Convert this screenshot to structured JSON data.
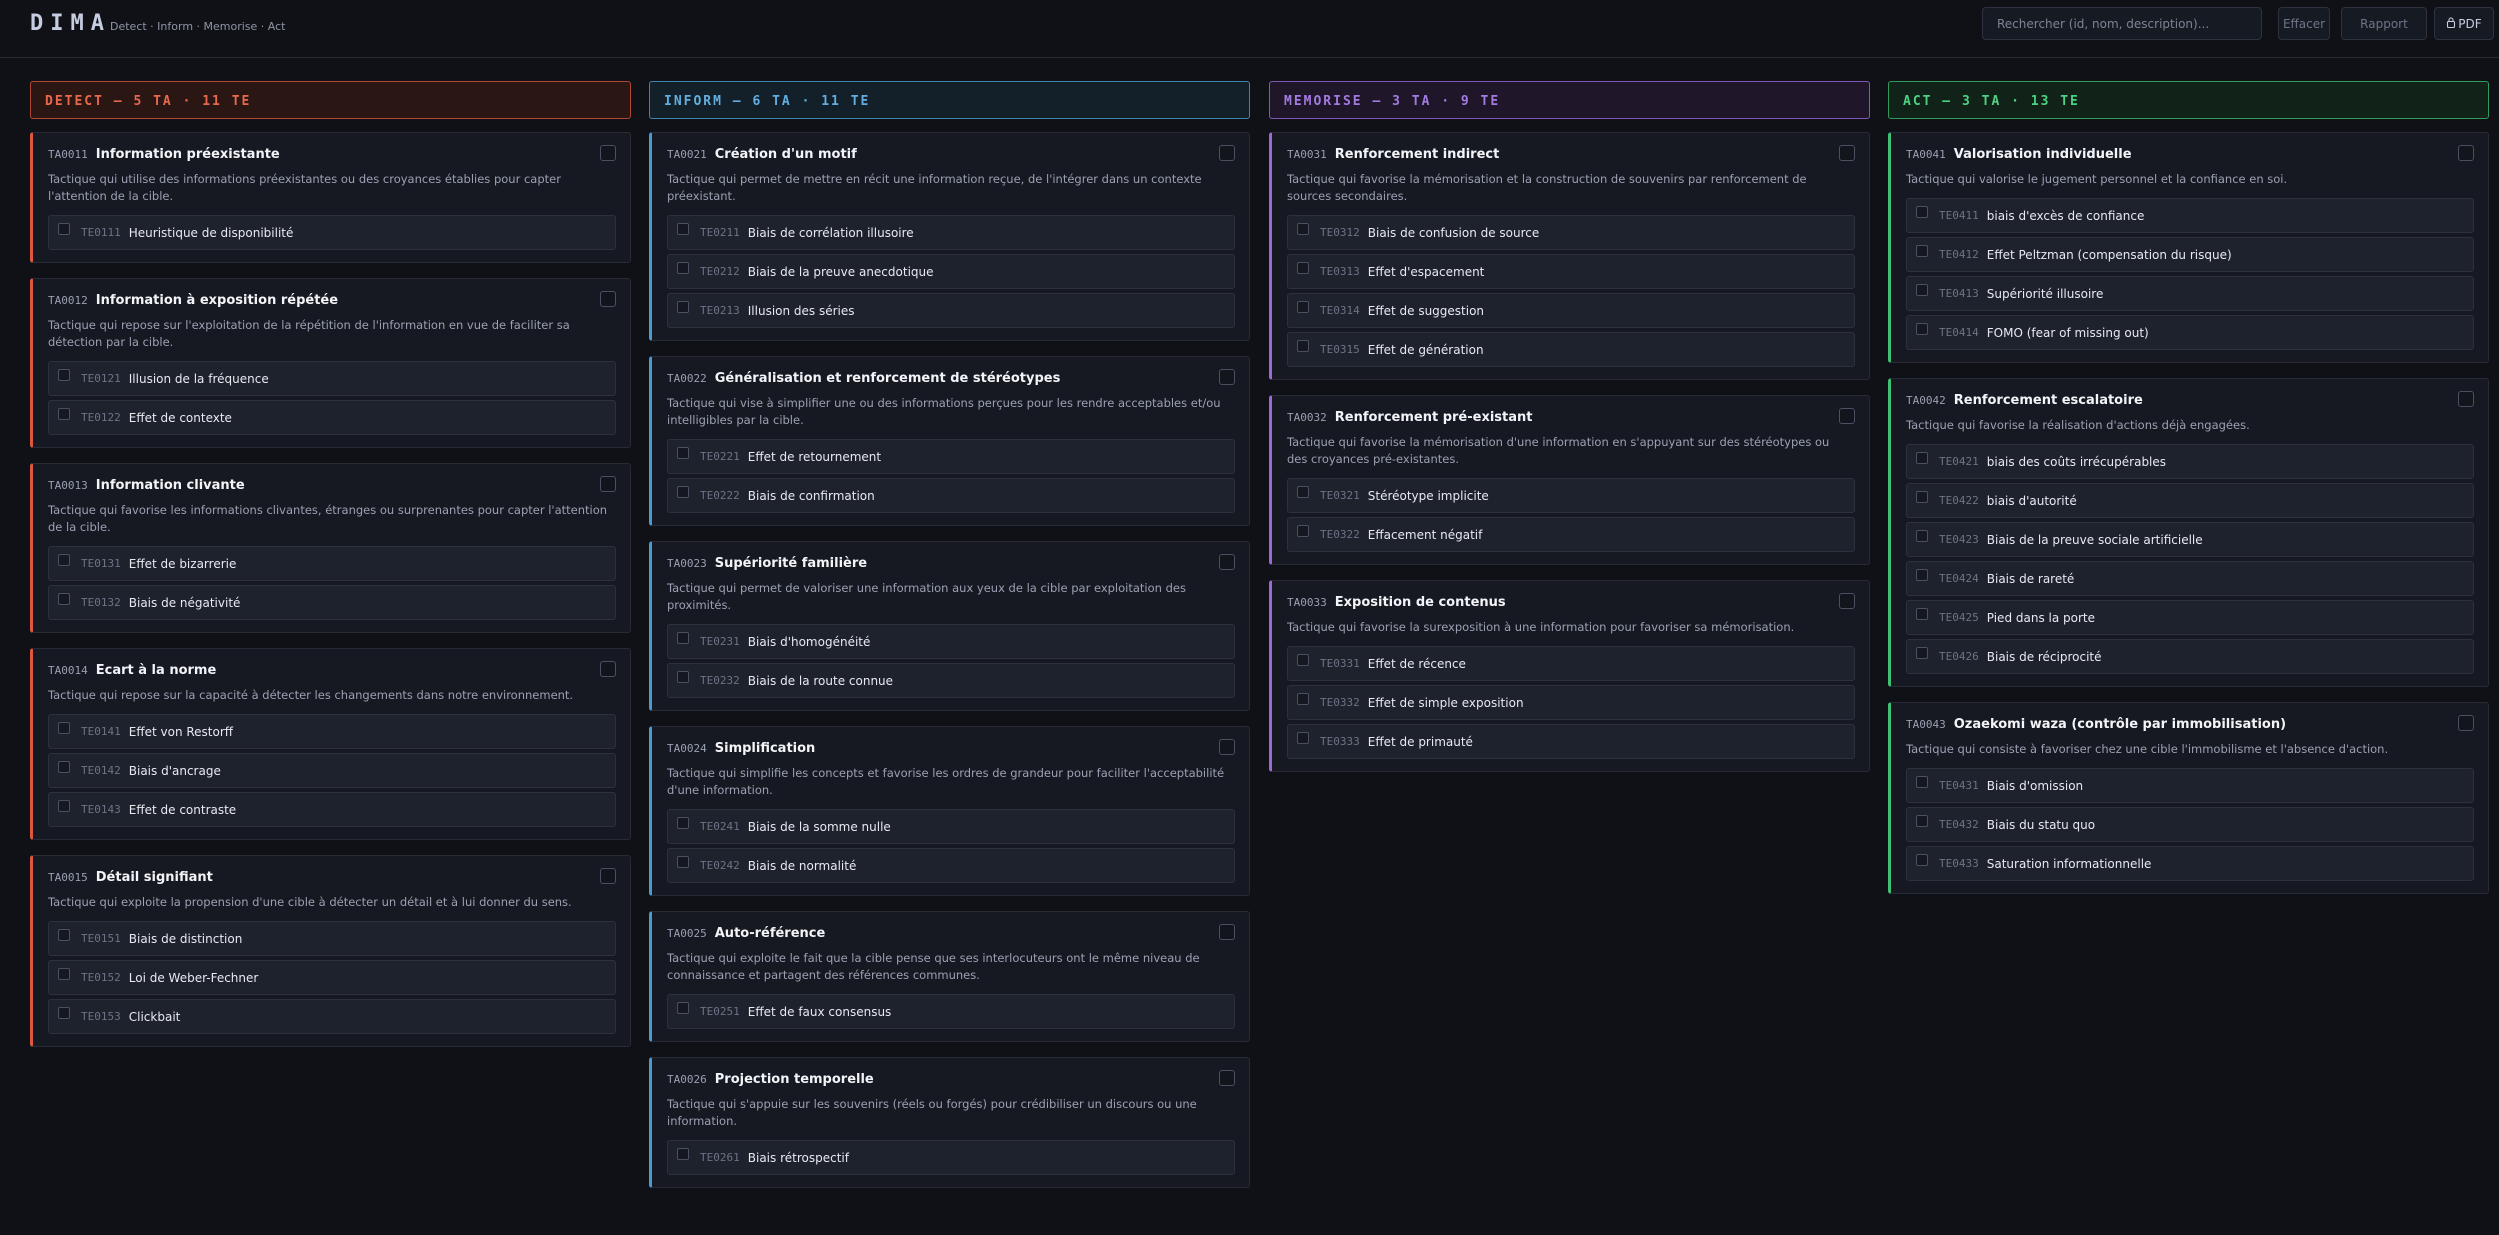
{
  "app": {
    "logo": "DIMA",
    "tagline": "Detect · Inform · Memorise · Act"
  },
  "toolbar": {
    "search_placeholder": "Rechercher (id, nom, description)...",
    "clear_label": "Effacer",
    "report_label": "Rapport",
    "pdf_label": "PDF",
    "pdf_icon": "lock-icon"
  },
  "colors": {
    "detect": "#e0573f",
    "inform": "#4a9bcf",
    "memorise": "#9a6ad6",
    "act": "#3fc174",
    "background": "#0f1117"
  },
  "columns": [
    {
      "header": "DETECT — 5 TA · 11 TE",
      "cards": [
        {
          "id": "TA0011",
          "name": "Information préexistante",
          "desc": "Tactique qui utilise des informations préexistantes ou des croyances établies pour capter l'attention de la cible.",
          "items": [
            {
              "id": "TE0111",
              "name": "Heuristique de disponibilité"
            }
          ]
        },
        {
          "id": "TA0012",
          "name": "Information à exposition répétée",
          "desc": "Tactique qui repose sur l'exploitation de la répétition de l'information en vue de faciliter sa détection par la cible.",
          "items": [
            {
              "id": "TE0121",
              "name": "Illusion de la fréquence"
            },
            {
              "id": "TE0122",
              "name": "Effet de contexte"
            }
          ]
        },
        {
          "id": "TA0013",
          "name": "Information clivante",
          "desc": "Tactique qui favorise les informations clivantes, étranges ou surprenantes pour capter l'attention de la cible.",
          "items": [
            {
              "id": "TE0131",
              "name": "Effet de bizarrerie"
            },
            {
              "id": "TE0132",
              "name": "Biais de négativité"
            }
          ]
        },
        {
          "id": "TA0014",
          "name": "Ecart à la norme",
          "desc": "Tactique qui repose sur la capacité à détecter les changements dans notre environnement.",
          "items": [
            {
              "id": "TE0141",
              "name": "Effet von Restorff"
            },
            {
              "id": "TE0142",
              "name": "Biais d'ancrage"
            },
            {
              "id": "TE0143",
              "name": "Effet de contraste"
            }
          ]
        },
        {
          "id": "TA0015",
          "name": "Détail signifiant",
          "desc": "Tactique qui exploite la propension d'une cible à détecter un détail et à lui donner du sens.",
          "items": [
            {
              "id": "TE0151",
              "name": "Biais de distinction"
            },
            {
              "id": "TE0152",
              "name": "Loi de Weber-Fechner"
            },
            {
              "id": "TE0153",
              "name": "Clickbait"
            }
          ]
        }
      ]
    },
    {
      "header": "INFORM — 6 TA · 11 TE",
      "cards": [
        {
          "id": "TA0021",
          "name": "Création d'un motif",
          "desc": "Tactique qui permet de mettre en récit une information reçue, de l'intégrer dans un contexte préexistant.",
          "items": [
            {
              "id": "TE0211",
              "name": "Biais de corrélation illusoire"
            },
            {
              "id": "TE0212",
              "name": "Biais de la preuve anecdotique"
            },
            {
              "id": "TE0213",
              "name": "Illusion des séries"
            }
          ]
        },
        {
          "id": "TA0022",
          "name": "Généralisation et renforcement de stéréotypes",
          "desc": "Tactique qui vise à simplifier une ou des informations perçues pour les rendre acceptables et/ou intelligibles par la cible.",
          "items": [
            {
              "id": "TE0221",
              "name": "Effet de retournement"
            },
            {
              "id": "TE0222",
              "name": "Biais de confirmation"
            }
          ]
        },
        {
          "id": "TA0023",
          "name": "Supériorité familière",
          "desc": "Tactique qui permet de valoriser une information aux yeux de la cible par exploitation des proximités.",
          "items": [
            {
              "id": "TE0231",
              "name": "Biais d'homogénéité"
            },
            {
              "id": "TE0232",
              "name": "Biais de la route connue"
            }
          ]
        },
        {
          "id": "TA0024",
          "name": "Simplification",
          "desc": "Tactique qui simplifie les concepts et favorise les ordres de grandeur pour faciliter l'acceptabilité d'une information.",
          "items": [
            {
              "id": "TE0241",
              "name": "Biais de la somme nulle"
            },
            {
              "id": "TE0242",
              "name": "Biais de normalité"
            }
          ]
        },
        {
          "id": "TA0025",
          "name": "Auto-référence",
          "desc": "Tactique qui exploite le fait que la cible pense que ses interlocuteurs ont le même niveau de connaissance et partagent des références communes.",
          "items": [
            {
              "id": "TE0251",
              "name": "Effet de faux consensus"
            }
          ]
        },
        {
          "id": "TA0026",
          "name": "Projection temporelle",
          "desc": "Tactique qui s'appuie sur les souvenirs (réels ou forgés) pour crédibiliser un discours ou une information.",
          "items": [
            {
              "id": "TE0261",
              "name": "Biais rétrospectif"
            }
          ]
        }
      ]
    },
    {
      "header": "MEMORISE — 3 TA · 9 TE",
      "cards": [
        {
          "id": "TA0031",
          "name": "Renforcement indirect",
          "desc": "Tactique qui favorise la mémorisation et la construction de souvenirs par renforcement de sources secondaires.",
          "items": [
            {
              "id": "TE0312",
              "name": "Biais de confusion de source"
            },
            {
              "id": "TE0313",
              "name": "Effet d'espacement"
            },
            {
              "id": "TE0314",
              "name": "Effet de suggestion"
            },
            {
              "id": "TE0315",
              "name": "Effet de génération"
            }
          ]
        },
        {
          "id": "TA0032",
          "name": "Renforcement pré-existant",
          "desc": "Tactique qui favorise la mémorisation d'une information en s'appuyant sur des stéréotypes ou des croyances pré-existantes.",
          "items": [
            {
              "id": "TE0321",
              "name": "Stéréotype implicite"
            },
            {
              "id": "TE0322",
              "name": "Effacement négatif"
            }
          ]
        },
        {
          "id": "TA0033",
          "name": "Exposition de contenus",
          "desc": "Tactique qui favorise la surexposition à une information pour favoriser sa mémorisation.",
          "items": [
            {
              "id": "TE0331",
              "name": "Effet de récence"
            },
            {
              "id": "TE0332",
              "name": "Effet de simple exposition"
            },
            {
              "id": "TE0333",
              "name": "Effet de primauté"
            }
          ]
        }
      ]
    },
    {
      "header": "ACT — 3 TA · 13 TE",
      "cards": [
        {
          "id": "TA0041",
          "name": "Valorisation individuelle",
          "desc": "Tactique qui valorise le jugement personnel et la confiance en soi.",
          "items": [
            {
              "id": "TE0411",
              "name": "biais d'excès de confiance"
            },
            {
              "id": "TE0412",
              "name": "Effet Peltzman (compensation du risque)"
            },
            {
              "id": "TE0413",
              "name": "Supériorité illusoire"
            },
            {
              "id": "TE0414",
              "name": "FOMO (fear of missing out)"
            }
          ]
        },
        {
          "id": "TA0042",
          "name": "Renforcement escalatoire",
          "desc": "Tactique qui favorise la réalisation d'actions déjà engagées.",
          "items": [
            {
              "id": "TE0421",
              "name": "biais des coûts irrécupérables"
            },
            {
              "id": "TE0422",
              "name": "biais d'autorité"
            },
            {
              "id": "TE0423",
              "name": "Biais de la preuve sociale artificielle"
            },
            {
              "id": "TE0424",
              "name": "Biais de rareté"
            },
            {
              "id": "TE0425",
              "name": "Pied dans la porte"
            },
            {
              "id": "TE0426",
              "name": "Biais de réciprocité"
            }
          ]
        },
        {
          "id": "TA0043",
          "name": "Ozaekomi waza (contrôle par immobilisation)",
          "desc": "Tactique qui consiste à favoriser chez une cible l'immobilisme et l'absence d'action.",
          "items": [
            {
              "id": "TE0431",
              "name": "Biais d'omission"
            },
            {
              "id": "TE0432",
              "name": "Biais du statu quo"
            },
            {
              "id": "TE0433",
              "name": "Saturation informationnelle"
            }
          ]
        }
      ]
    }
  ]
}
